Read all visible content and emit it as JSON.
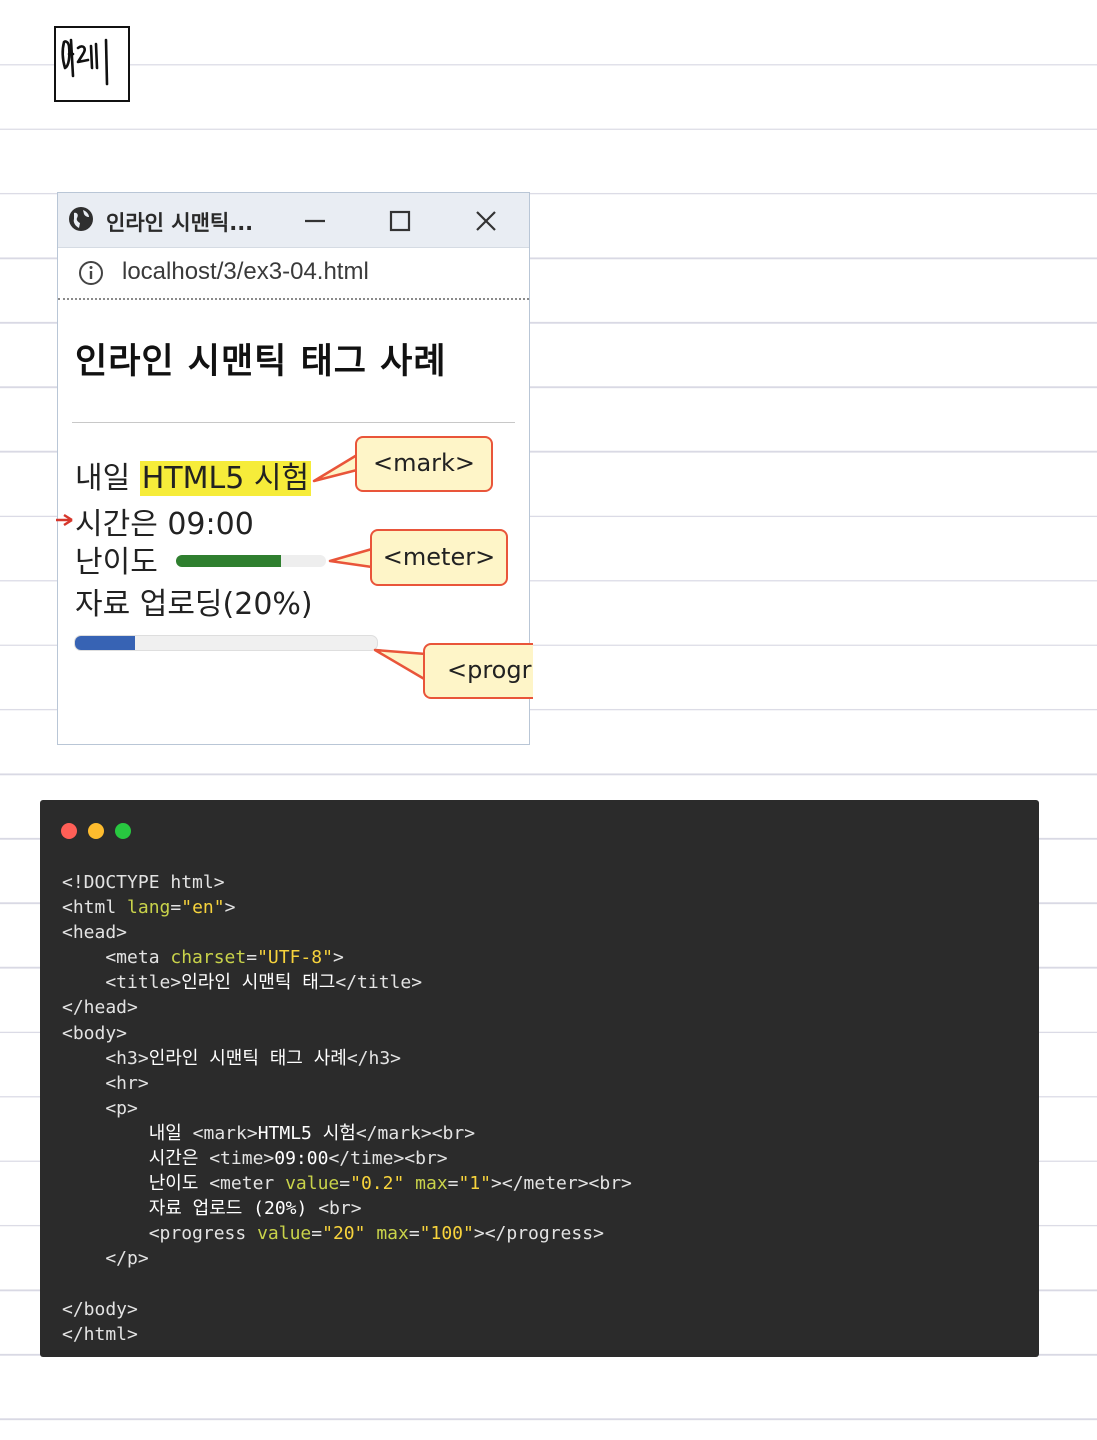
{
  "colors": {
    "mark_highlight": "#f6ec3a",
    "callout_border": "#e9553a",
    "callout_fill": "#fef5c8",
    "meter_fill": "#2f7f2f",
    "progress_fill": "#3763b4",
    "code_bg": "#2b2b2b",
    "dot_red": "#ff5f57",
    "dot_yellow": "#febc2e",
    "dot_green": "#28c840"
  },
  "browser": {
    "tab_title": "인라인 시맨틱...",
    "url": "localhost/3/ex3-04.html",
    "icons": [
      "globe-icon",
      "minimize-icon",
      "maximize-icon",
      "close-icon",
      "info-icon"
    ],
    "page": {
      "h3": "인라인 시맨틱 태그 사례",
      "line1_prefix": "내일 ",
      "mark_text": "HTML5 시험",
      "line2": "시간은 09:00",
      "line3_label": "난이도",
      "meter_value": 0.7,
      "line4": "자료 업로딩(20%)",
      "progress_value": 0.2
    },
    "callouts": {
      "mark": "<mark>",
      "meter": "<meter>",
      "progress": "<progr"
    }
  },
  "code": {
    "lines": [
      [
        [
          "tag",
          "<!DOCTYPE html>"
        ]
      ],
      [
        [
          "tag",
          "<html "
        ],
        [
          "attr",
          "lang"
        ],
        [
          "tag",
          "="
        ],
        [
          "str",
          "\"en\""
        ],
        [
          "tag",
          ">"
        ]
      ],
      [
        [
          "tag",
          "<head>"
        ]
      ],
      [
        [
          "tag",
          "    <meta "
        ],
        [
          "attr",
          "charset"
        ],
        [
          "tag",
          "="
        ],
        [
          "str",
          "\"UTF-8\""
        ],
        [
          "tag",
          ">"
        ]
      ],
      [
        [
          "tag",
          "    <title>"
        ],
        [
          "txt",
          "인라인 시맨틱 태그"
        ],
        [
          "tag",
          "</title>"
        ]
      ],
      [
        [
          "tag",
          "</head>"
        ]
      ],
      [
        [
          "tag",
          "<body>"
        ]
      ],
      [
        [
          "tag",
          "    <h3>"
        ],
        [
          "txt",
          "인라인 시맨틱 태그 사례"
        ],
        [
          "tag",
          "</h3>"
        ]
      ],
      [
        [
          "tag",
          "    <hr>"
        ]
      ],
      [
        [
          "tag",
          "    <p>"
        ]
      ],
      [
        [
          "txt",
          "        내일 "
        ],
        [
          "tag",
          "<mark>"
        ],
        [
          "txt",
          "HTML5 시험"
        ],
        [
          "tag",
          "</mark><br>"
        ]
      ],
      [
        [
          "txt",
          "        시간은 "
        ],
        [
          "tag",
          "<time>"
        ],
        [
          "txt",
          "09:00"
        ],
        [
          "tag",
          "</time><br>"
        ]
      ],
      [
        [
          "txt",
          "        난이도 "
        ],
        [
          "tag",
          "<meter "
        ],
        [
          "attr",
          "value"
        ],
        [
          "tag",
          "="
        ],
        [
          "str",
          "\"0.2\""
        ],
        [
          "tag",
          " "
        ],
        [
          "attr",
          "max"
        ],
        [
          "tag",
          "="
        ],
        [
          "str",
          "\"1\""
        ],
        [
          "tag",
          "></meter><br>"
        ]
      ],
      [
        [
          "txt",
          "        자료 업로드 (20%) "
        ],
        [
          "tag",
          "<br>"
        ]
      ],
      [
        [
          "tag",
          "        <progress "
        ],
        [
          "attr",
          "value"
        ],
        [
          "tag",
          "="
        ],
        [
          "str",
          "\"20\""
        ],
        [
          "tag",
          " "
        ],
        [
          "attr",
          "max"
        ],
        [
          "tag",
          "="
        ],
        [
          "str",
          "\"100\""
        ],
        [
          "tag",
          "></progress>"
        ]
      ],
      [
        [
          "tag",
          "    </p>"
        ]
      ],
      [
        [
          "tag",
          ""
        ]
      ],
      [
        [
          "tag",
          "</body>"
        ]
      ],
      [
        [
          "tag",
          "</html>"
        ]
      ]
    ]
  }
}
